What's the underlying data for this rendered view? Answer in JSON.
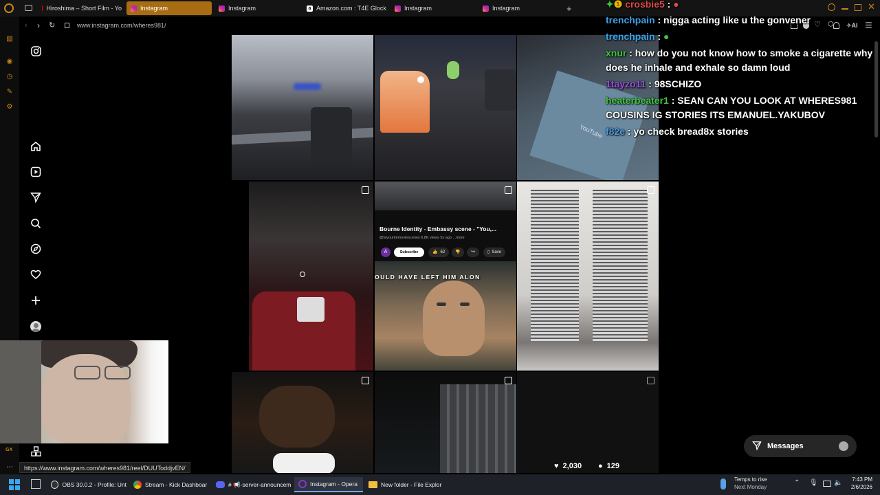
{
  "browser": {
    "tabs": [
      {
        "label": "Hiroshima – Short Film - Yo",
        "icon": "youtube-icon",
        "active": false
      },
      {
        "label": "Instagram",
        "icon": "instagram-icon",
        "active": true
      },
      {
        "label": "Instagram",
        "icon": "instagram-icon",
        "active": false
      },
      {
        "label": "Amazon.com : T4E Glock",
        "icon": "amazon-icon",
        "active": false
      },
      {
        "label": "Instagram",
        "icon": "instagram-icon",
        "active": false
      },
      {
        "label": "Instagram",
        "icon": "instagram-icon",
        "active": false
      }
    ],
    "url": "www.instagram.com/wheres981/",
    "ai_label": "AI",
    "status_url": "https://www.instagram.com/wheres981/reel/DUUToddjvEN/",
    "gx_label": "GX"
  },
  "post_overlay": {
    "video_title": "Bourne Identity - Embassy scene - \"You,...",
    "channel_meta": "@favouritemoviescenes  6.8K views  5y ago  ...more",
    "subscribe": "Subscribe",
    "likes": "62",
    "save": "Save",
    "banner_text": "OULD HAVE LEFT HIM ALON",
    "avatar_letter": "A"
  },
  "hover_stats": {
    "likes": "2,030",
    "comments": "129"
  },
  "messages_label": "Messages",
  "chat": [
    {
      "user": "crosbie5",
      "text": ":",
      "color": "#e04848"
    },
    {
      "user": "trenchpain",
      "text": ": nigga acting like u the gonvener",
      "color": "#3aa0e8"
    },
    {
      "user": "trenchpain",
      "text": ":",
      "color": "#3aa0e8"
    },
    {
      "user": "xnur",
      "text": ": how do you not know how to smoke a cigarette why",
      "color": "#3fc43f"
    },
    {
      "user": "",
      "text": "does he inhale and exhale so damn loud",
      "color": "#ffffff"
    },
    {
      "user": "1tayzo11",
      "text": ": 98SCHIZO",
      "color": "#9a4fe0"
    },
    {
      "user": "heaterbeater1",
      "text": ": SEAN CAN YOU LOOK AT WHERES981",
      "color": "#3fc43f"
    },
    {
      "user": "",
      "text": "COUSINS IG STORIES ITS EMANUEL.YAKUBOV",
      "color": "#ffffff"
    },
    {
      "user": "f82e",
      "text": ": yo check bread8x stories",
      "color": "#4a9be0"
    }
  ],
  "taskbar": {
    "apps": [
      {
        "label": "OBS 30.0.2 - Profile: Unt",
        "icon": "obs-icon"
      },
      {
        "label": "Stream - Kick Dashboar",
        "icon": "chrome-icon"
      },
      {
        "label": "# 📢-server-announcem",
        "icon": "discord-icon"
      },
      {
        "label": "Instagram - Opera",
        "icon": "opera-icon"
      },
      {
        "label": "New folder - File Explor",
        "icon": "folder-icon"
      }
    ],
    "weather_line1": "Temps to rise",
    "weather_line2": "Next Monday",
    "time": "7:43 PM",
    "date": "2/6/2026"
  },
  "colors": {
    "opera_accent": "#c8861a",
    "active_tab": "#a86c12",
    "taskbar": "#1e2228"
  }
}
